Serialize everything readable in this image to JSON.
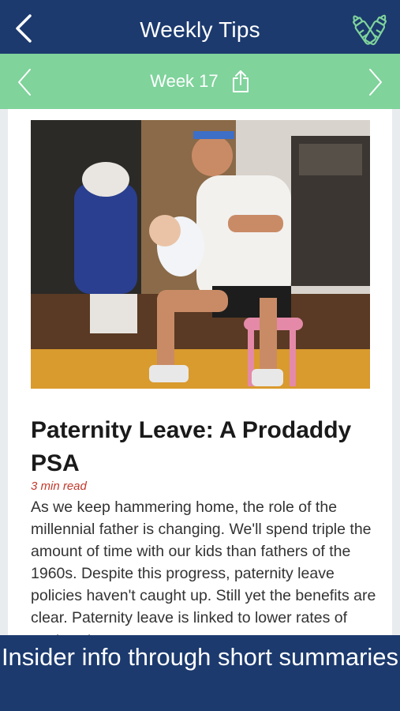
{
  "header": {
    "title": "Weekly Tips",
    "back_icon": "chevron-left-icon",
    "right_icon": "baby-bottles-icon"
  },
  "week_nav": {
    "label": "Week 17",
    "prev_icon": "chevron-left-icon",
    "next_icon": "chevron-right-icon",
    "share_icon": "share-icon"
  },
  "article": {
    "image_alt": "Father doing squats while holding a baby",
    "title": "Paternity Leave: A Prodaddy PSA",
    "read_time": "3 min read",
    "body": "As we keep hammering home, the role of the millennial father is changing. We'll spend triple the amount of time with our kids than fathers of the 1960s.  Despite this progress, paternity leave policies haven't caught up. Still yet the benefits are clear. Paternity leave is linked to lower rates of post-partum"
  },
  "footer": {
    "caption": "Insider info through short summaries"
  },
  "colors": {
    "header_bg": "#1c3a6e",
    "week_bar_bg": "#7fd39b",
    "read_time": "#c0392b"
  }
}
